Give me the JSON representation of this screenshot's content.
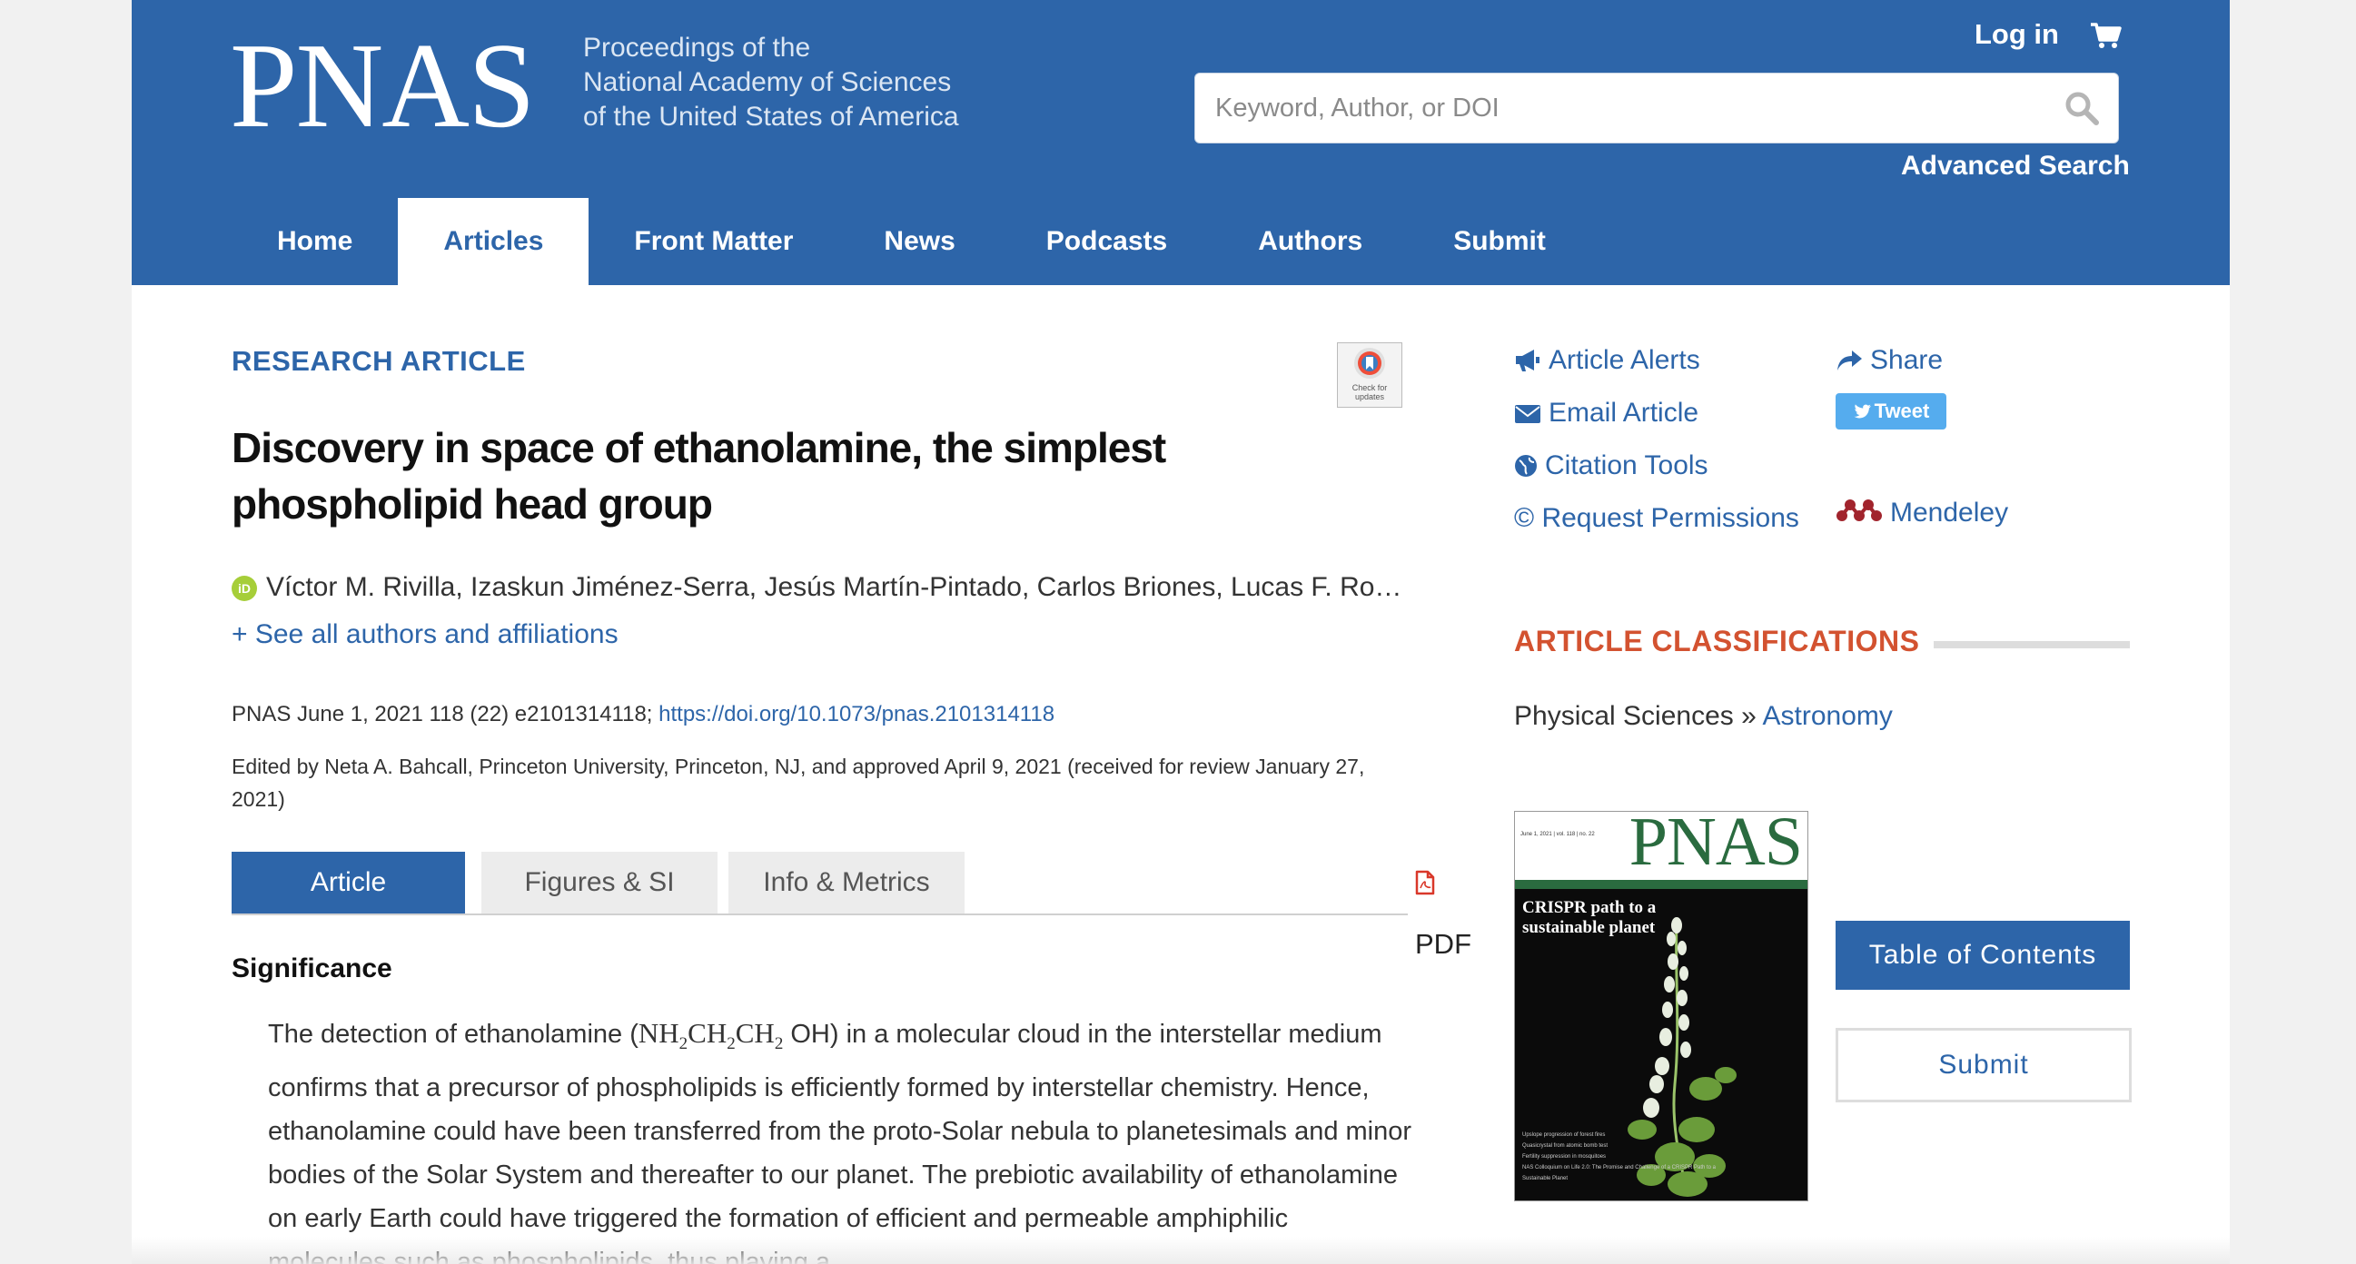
{
  "header": {
    "logo": "PNAS",
    "tagline": [
      "Proceedings of the",
      "National Academy of Sciences",
      "of the United States of America"
    ],
    "login_label": "Log in",
    "search_placeholder": "Keyword, Author, or DOI",
    "advanced_search": "Advanced Search",
    "nav": [
      {
        "label": "Home",
        "active": false
      },
      {
        "label": "Articles",
        "active": true
      },
      {
        "label": "Front Matter",
        "active": false
      },
      {
        "label": "News",
        "active": false
      },
      {
        "label": "Podcasts",
        "active": false
      },
      {
        "label": "Authors",
        "active": false
      },
      {
        "label": "Submit",
        "active": false
      }
    ]
  },
  "article": {
    "type_label": "RESEARCH ARTICLE",
    "crossmark_text": "Check for updates",
    "title": "Discovery in space of ethanolamine, the simplest phospholipid head group",
    "orcid_label": "iD",
    "authors": "Víctor M. Rivilla, Izaskun Jiménez-Serra, Jesús Martín-Pintado, Carlos Briones, Lucas F. Ro…",
    "see_all": "+ See all authors and affiliations",
    "citation": "PNAS June 1, 2021 118 (22) e2101314118; ",
    "doi": "https://doi.org/10.1073/pnas.2101314118",
    "edited_by": "Edited by Neta A. Bahcall, Princeton University, Princeton, NJ, and approved April 9, 2021 (received for review January 27, 2021)",
    "tabs": [
      {
        "label": "Article",
        "active": true
      },
      {
        "label": "Figures & SI",
        "active": false
      },
      {
        "label": "Info & Metrics",
        "active": false
      }
    ],
    "pdf_label": "PDF",
    "significance_heading": "Significance",
    "significance": {
      "pre": "The detection of ethanolamine (",
      "formula_nh": "NH",
      "formula_ch": "CH",
      "formula_sub": "2",
      "formula_oh": " OH",
      "post": ") in a molecular cloud in the interstellar medium confirms that a precursor of phospholipids is efficiently formed by interstellar chemistry. Hence, ethanolamine could have been transferred from the proto-Solar nebula to planetesimals and minor bodies of the Solar System and thereafter to our planet. The prebiotic availability of ethanolamine on early Earth could have triggered the formation of efficient and permeable amphiphilic molecules such as phospholipids, thus playing a"
    }
  },
  "sidebar": {
    "tools": {
      "article_alerts": "Article Alerts",
      "email_article": "Email Article",
      "citation_tools": "Citation Tools",
      "request_permissions": "© Request Permissions",
      "share": "Share",
      "tweet": "Tweet",
      "mendeley": "Mendeley"
    },
    "classifications_heading": "ARTICLE CLASSIFICATIONS",
    "classification_field": "Physical Sciences",
    "classification_sep": " » ",
    "classification_link": "Astronomy",
    "cover": {
      "logo": "PNAS",
      "meta": "June 1, 2021 | vol. 118 | no. 22",
      "headline": "CRISPR path to a sustainable planet",
      "footer_lines": [
        "Upslope progression of forest fires",
        "Quasicrystal from atomic bomb test",
        "Fertility suppression in mosquitoes",
        "NAS Colloquium on Life 2.0: The Promise and Challenge of a CRISPR Path to a Sustainable Planet"
      ]
    },
    "toc_button": "Table of Contents",
    "submit_button": "Submit"
  },
  "colors": {
    "brand_blue": "#2d65a9",
    "classification_orange": "#d35230",
    "twitter_blue": "#55acee",
    "orcid_green": "#a6ce39",
    "cover_green": "#2a6b3f"
  },
  "icons": [
    "cart-icon",
    "search-icon",
    "megaphone-icon",
    "envelope-icon",
    "globe-icon",
    "share-icon",
    "twitter-icon",
    "mendeley-icon",
    "pdf-icon",
    "crossmark-icon"
  ]
}
